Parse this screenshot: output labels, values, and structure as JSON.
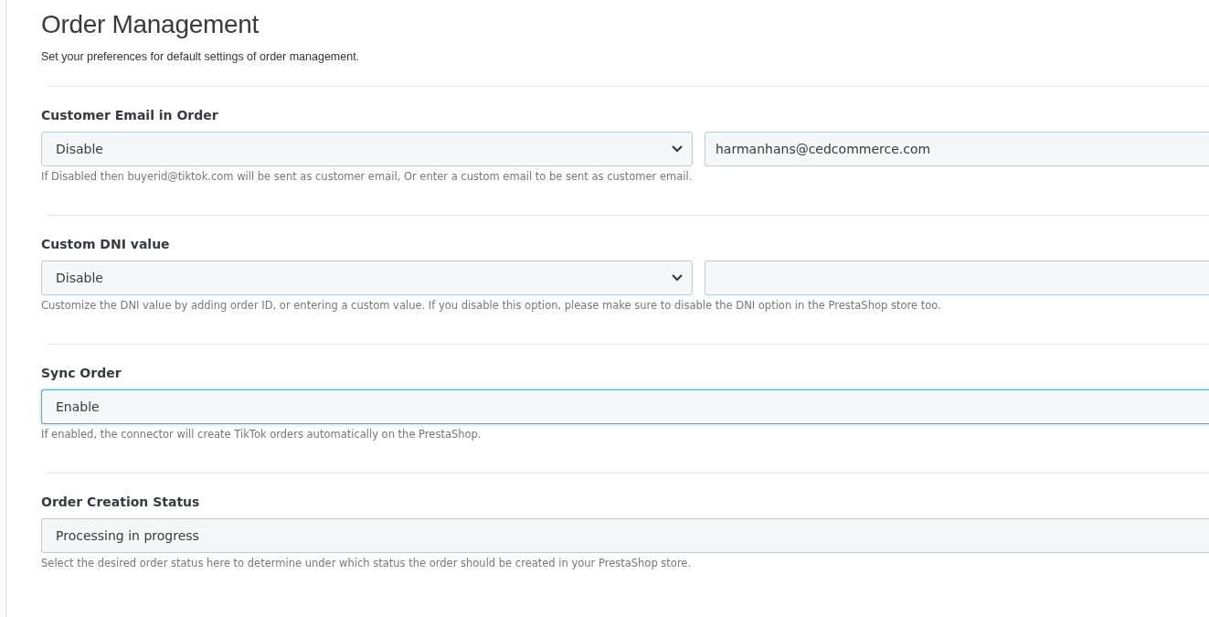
{
  "header": {
    "title": "Order Management",
    "subtitle": "Set your preferences for default settings of order management."
  },
  "settings": [
    {
      "label": "Customer Email in Order",
      "kind": "select_with_input",
      "select": "Disable",
      "focused": false,
      "input": "harmanhans@cedcommerce.com",
      "help": "If Disabled then buyerid@tiktok.com will be sent as customer email, Or enter a custom email to be sent as customer email."
    },
    {
      "label": "Custom DNI value",
      "kind": "select_with_input",
      "select": "Disable",
      "focused": false,
      "help": "Customize the DNI value by adding order ID, or entering a custom value. If you disable this option, please make sure to disable the DNI option in the PrestaShop store too."
    },
    {
      "label": "Sync Order",
      "kind": "select",
      "select": "Enable",
      "focused": true,
      "help": "If enabled, the connector will create TikTok orders automatically on the PrestaShop."
    },
    {
      "label": "Order Creation Status",
      "kind": "select",
      "select": "Processing in progress",
      "focused": false,
      "help": "Select the desired order status here to determine under which status the order should be created in your PrestaShop store."
    }
  ]
}
